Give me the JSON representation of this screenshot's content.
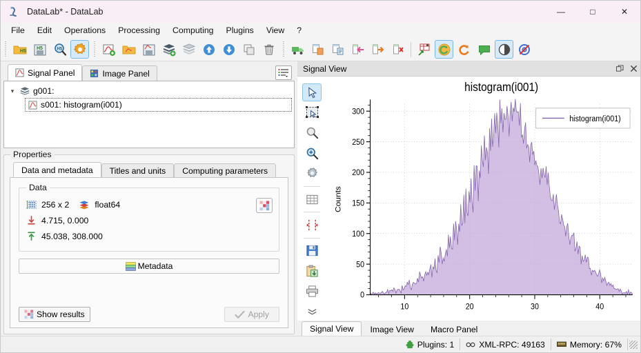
{
  "window": {
    "title": "DataLab* - DataLab",
    "app_icon": "datalab-logo-icon",
    "minimize": "—",
    "maximize": "□",
    "close": "✕"
  },
  "menubar": {
    "items": [
      {
        "label": "File",
        "name": "menu-file"
      },
      {
        "label": "Edit",
        "name": "menu-edit"
      },
      {
        "label": "Operations",
        "name": "menu-operations"
      },
      {
        "label": "Processing",
        "name": "menu-processing"
      },
      {
        "label": "Computing",
        "name": "menu-computing"
      },
      {
        "label": "Plugins",
        "name": "menu-plugins"
      },
      {
        "label": "View",
        "name": "menu-view"
      },
      {
        "label": "?",
        "name": "menu-help"
      }
    ]
  },
  "toolbar": {
    "group1": [
      {
        "name": "open-hdf5-button",
        "icon": "folder-h5-icon"
      },
      {
        "name": "save-hdf5-button",
        "icon": "floppy-h5-icon"
      },
      {
        "name": "browse-hdf5-button",
        "icon": "magnifier-h5-icon"
      },
      {
        "name": "settings-button",
        "icon": "gear-orange-icon",
        "checked": true
      }
    ],
    "group2": [
      {
        "name": "new-signal-button",
        "icon": "signal-new-icon"
      },
      {
        "name": "open-signal-button",
        "icon": "folder-signal-icon"
      },
      {
        "name": "save-signal-button",
        "icon": "floppy-signal-icon"
      },
      {
        "name": "new-group-button",
        "icon": "layers-add-icon"
      },
      {
        "name": "group-button",
        "icon": "layers-icon"
      },
      {
        "name": "move-up-button",
        "icon": "arrow-up-circle-icon"
      },
      {
        "name": "move-down-button",
        "icon": "arrow-down-circle-icon"
      },
      {
        "name": "duplicate-button",
        "icon": "duplicate-icon"
      },
      {
        "name": "delete-button",
        "icon": "trash-icon"
      }
    ],
    "group3": [
      {
        "name": "import-button",
        "icon": "truck-icon"
      },
      {
        "name": "copy-page-button",
        "icon": "copy-orange-icon"
      },
      {
        "name": "paste-page-button",
        "icon": "paste-blue-icon"
      },
      {
        "name": "insert-before-button",
        "icon": "arrow-left-pink-icon"
      },
      {
        "name": "insert-after-button",
        "icon": "arrow-right-orange-icon"
      },
      {
        "name": "remove-page-button",
        "icon": "remove-cross-icon"
      }
    ],
    "group4": [
      {
        "name": "plot-options-button",
        "icon": "plot-arrow-icon"
      },
      {
        "name": "auto-refresh-button",
        "icon": "refresh-circle-icon",
        "checked": true
      },
      {
        "name": "refresh-button",
        "icon": "refresh-orange-icon"
      },
      {
        "name": "annotations-button",
        "icon": "speech-bubble-icon"
      },
      {
        "name": "contrast-button",
        "icon": "contrast-circle-icon",
        "checked": true
      },
      {
        "name": "no-target-button",
        "icon": "target-crossed-icon"
      }
    ]
  },
  "left_panel": {
    "tabs": [
      {
        "label": "Signal Panel",
        "name": "tab-signal-panel",
        "icon": "signal-icon",
        "active": true
      },
      {
        "label": "Image Panel",
        "name": "tab-image-panel",
        "icon": "image-icon",
        "active": false
      }
    ],
    "options_button": "list-options-icon",
    "tree": {
      "group": {
        "label": "g001:",
        "icon": "layers-icon",
        "expanded": true
      },
      "items": [
        {
          "label": "s001: histogram(i001)",
          "icon": "signal-icon",
          "selected": true
        }
      ]
    },
    "properties": {
      "legend": "Properties",
      "tabs": [
        {
          "label": "Data and metadata",
          "name": "tab-data-and-metadata",
          "active": true
        },
        {
          "label": "Titles and units",
          "name": "tab-titles-and-units",
          "active": false
        },
        {
          "label": "Computing parameters",
          "name": "tab-computing-parameters",
          "active": false
        }
      ],
      "data_group": {
        "legend": "Data",
        "shape": "256 x 2",
        "dtype": "float64",
        "min_values": "4.715, 0.000",
        "max_values": "45.038, 308.000",
        "shape_icon": "grid-measure-icon",
        "dtype_icon": "layers-color-icon",
        "min_icon": "arrow-down-red-icon",
        "max_icon": "arrow-up-green-icon",
        "palette_button": "color-swatch-icon"
      },
      "metadata_button": {
        "label": "Metadata",
        "icon": "metadata-icon"
      },
      "show_results_button": {
        "label": "Show results",
        "icon": "results-grid-icon"
      },
      "apply_button": {
        "label": "Apply",
        "icon": "check-icon",
        "enabled": false
      }
    }
  },
  "signal_view": {
    "dock_title": "Signal View",
    "dock_float_button": "float-icon",
    "dock_close_button": "close-icon",
    "tools": [
      {
        "name": "tool-select-pointer",
        "icon": "cursor-arrow-icon",
        "checked": true
      },
      {
        "name": "tool-rect-selection",
        "icon": "selection-rect-icon",
        "checked": false
      },
      {
        "name": "tool-zoom-out",
        "icon": "magnifier-grey-icon",
        "checked": false
      },
      {
        "name": "tool-zoom-in",
        "icon": "magnifier-blue-icon",
        "checked": false
      },
      {
        "name": "tool-item-settings",
        "icon": "gear-icon",
        "checked": false
      },
      {
        "name": "tool-grid",
        "icon": "grid-icon",
        "checked": false
      },
      {
        "name": "tool-x-cursor",
        "icon": "x-range-cursor-icon",
        "checked": false
      },
      {
        "name": "tool-save-plot",
        "icon": "floppy-icon",
        "checked": false
      },
      {
        "name": "tool-copy-plot",
        "icon": "clipboard-icon",
        "checked": false
      },
      {
        "name": "tool-print-plot",
        "icon": "printer-icon",
        "checked": false
      },
      {
        "name": "tool-more",
        "icon": "chevrons-down-icon",
        "checked": false
      }
    ],
    "bottom_tabs": [
      {
        "label": "Signal View",
        "name": "tab-signal-view",
        "active": true
      },
      {
        "label": "Image View",
        "name": "tab-image-view",
        "active": false
      },
      {
        "label": "Macro Panel",
        "name": "tab-macro-panel",
        "active": false
      }
    ]
  },
  "statusbar": {
    "plugins": {
      "label": "Plugins: 1",
      "icon": "plugin-icon"
    },
    "xmlrpc": {
      "label": "XML-RPC: 49163",
      "icon": "link-icon"
    },
    "memory": {
      "label": "Memory: 67%",
      "icon": "memory-icon"
    }
  },
  "chart_data": {
    "type": "area",
    "title": "histogram(i001)",
    "xlabel": "",
    "ylabel": "Counts",
    "xlim": [
      4.715,
      45.038
    ],
    "ylim": [
      0,
      308
    ],
    "xticks": [
      10,
      20,
      30,
      40
    ],
    "yticks": [
      0,
      50,
      100,
      150,
      200,
      250,
      300
    ],
    "grid": true,
    "legend_position": "top-right",
    "series": [
      {
        "name": "histogram(i001)",
        "line_color": "#8466ad",
        "fill_color": "#c3a6da",
        "n_points": 256,
        "x_start": 4.715,
        "x_end": 45.038,
        "values": [
          2,
          1,
          3,
          2,
          1,
          4,
          2,
          3,
          5,
          2,
          4,
          3,
          6,
          4,
          2,
          5,
          3,
          6,
          4,
          7,
          5,
          8,
          6,
          9,
          7,
          5,
          10,
          8,
          12,
          9,
          7,
          13,
          10,
          15,
          12,
          9,
          17,
          14,
          20,
          16,
          13,
          22,
          18,
          25,
          21,
          17,
          28,
          24,
          32,
          26,
          22,
          35,
          30,
          38,
          33,
          28,
          42,
          36,
          46,
          40,
          35,
          50,
          44,
          55,
          48,
          42,
          60,
          53,
          66,
          58,
          50,
          72,
          64,
          80,
          70,
          62,
          88,
          78,
          96,
          85,
          75,
          104,
          93,
          114,
          101,
          90,
          124,
          110,
          134,
          120,
          107,
          146,
          130,
          158,
          141,
          126,
          170,
          152,
          183,
          164,
          148,
          196,
          176,
          210,
          189,
          170,
          224,
          202,
          238,
          215,
          194,
          252,
          228,
          262,
          240,
          218,
          272,
          250,
          282,
          262,
          240,
          290,
          270,
          296,
          278,
          258,
          302,
          284,
          308,
          292,
          272,
          300,
          286,
          305,
          294,
          276,
          302,
          290,
          308,
          296,
          280,
          300,
          288,
          295,
          282,
          265,
          288,
          275,
          280,
          268,
          250,
          272,
          258,
          262,
          248,
          232,
          254,
          240,
          244,
          228,
          212,
          234,
          220,
          224,
          208,
          192,
          214,
          200,
          204,
          188,
          172,
          194,
          180,
          184,
          168,
          152,
          174,
          160,
          164,
          148,
          134,
          154,
          141,
          144,
          129,
          116,
          134,
          122,
          125,
          111,
          99,
          116,
          105,
          108,
          95,
          84,
          99,
          89,
          92,
          80,
          70,
          84,
          75,
          78,
          67,
          58,
          70,
          62,
          65,
          55,
          47,
          58,
          50,
          53,
          44,
          37,
          47,
          40,
          43,
          35,
          29,
          38,
          32,
          34,
          27,
          22,
          29,
          24,
          26,
          20,
          16,
          22,
          18,
          19,
          14,
          11,
          16,
          12,
          13,
          9,
          7,
          11,
          8,
          9,
          6,
          4,
          7,
          5,
          6,
          4,
          3,
          5,
          3,
          4,
          2,
          3
        ]
      }
    ]
  }
}
